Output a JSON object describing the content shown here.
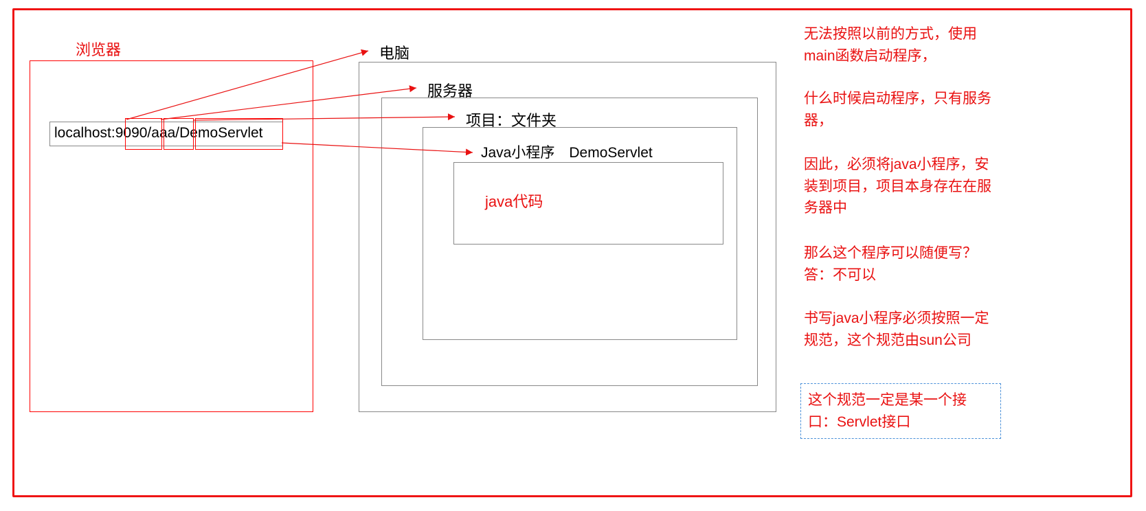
{
  "browser": {
    "title": "浏览器",
    "url_full": "localhost:9090/aaa/DemoServlet",
    "url_seg1": "localhost",
    "url_seg2": "9090",
    "url_seg3": "aaa",
    "url_seg4": "DemoServlet"
  },
  "computer": {
    "label": "电脑"
  },
  "server": {
    "label": "服务器"
  },
  "project": {
    "label": "项目：文件夹"
  },
  "mini": {
    "label": "Java小程序　DemoServlet",
    "code_label": "java代码"
  },
  "notes": {
    "n1": "无法按照以前的方式，使用main函数启动程序，",
    "n2": "什么时候启动程序，只有服务器，",
    "n3": "因此，必须将java小程序，安装到项目，项目本身存在在服务器中",
    "n4": "那么这个程序可以随便写？答：不可以",
    "n5": "书写java小程序必须按照一定规范，这个规范由sun公司",
    "n6": "这个规范一定是某一个接口：Servlet接口"
  }
}
